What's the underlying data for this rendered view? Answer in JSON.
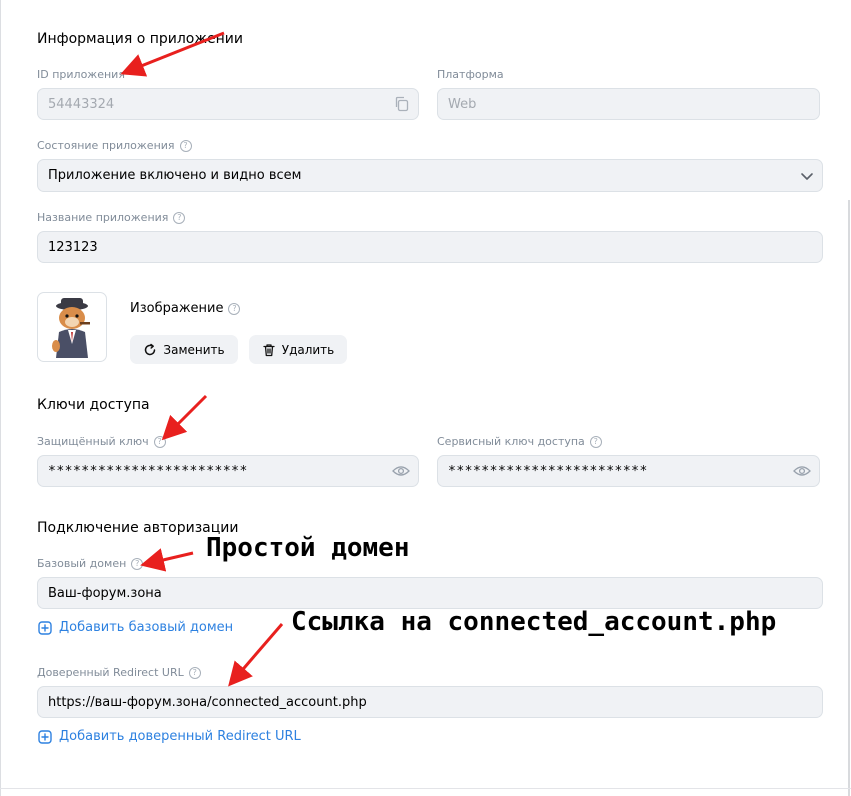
{
  "app_info": {
    "title": "Информация о приложении",
    "id_label": "ID приложения",
    "id_value": "54443324",
    "platform_label": "Платформа",
    "platform_value": "Web",
    "state_label": "Состояние приложения",
    "state_value": "Приложение включено и видно всем",
    "name_label": "Название приложения",
    "name_value": "123123",
    "image_label": "Изображение",
    "replace_label": "Заменить",
    "delete_label": "Удалить"
  },
  "access_keys": {
    "title": "Ключи доступа",
    "secure_key_label": "Защищённый ключ",
    "secure_key_value": "************************",
    "service_key_label": "Сервисный ключ доступа",
    "service_key_value": "************************"
  },
  "auth": {
    "title": "Подключение авторизации",
    "base_domain_label": "Базовый домен",
    "base_domain_value": "Ваш-форум.зона",
    "add_base_domain": "Добавить базовый домен",
    "redirect_label": "Доверенный Redirect URL",
    "redirect_value": "https://ваш-форум.зона/connected_account.php",
    "add_redirect": "Добавить доверенный Redirect URL"
  },
  "annotations": {
    "simple_domain": "Простой домен",
    "link_hint": "Ссылка на connected_account.php"
  },
  "help_glyph": "?",
  "colors": {
    "accent": "#2d81e0",
    "field_bg": "#f0f2f5",
    "label_gray": "#818c99",
    "arrow_red": "#e8201e"
  }
}
